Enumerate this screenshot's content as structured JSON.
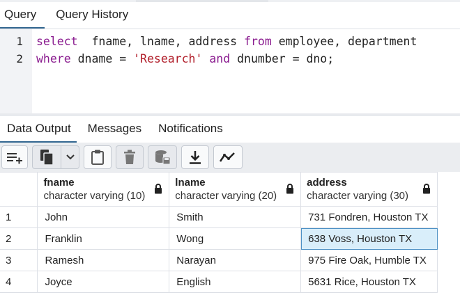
{
  "top_tabs": [
    {
      "label": "Query",
      "active": true
    },
    {
      "label": "Query History",
      "active": false
    }
  ],
  "editor": {
    "line_numbers": [
      "1",
      "2"
    ],
    "lines": [
      [
        {
          "text": "select",
          "kind": "kw"
        },
        {
          "text": "  fname, lname, address ",
          "kind": "plain"
        },
        {
          "text": "from",
          "kind": "kw"
        },
        {
          "text": " employee, department",
          "kind": "plain"
        }
      ],
      [
        {
          "text": "where",
          "kind": "kw"
        },
        {
          "text": " dname = ",
          "kind": "plain"
        },
        {
          "text": "'Research'",
          "kind": "str"
        },
        {
          "text": " ",
          "kind": "plain"
        },
        {
          "text": "and",
          "kind": "kw"
        },
        {
          "text": " dnumber = dno;",
          "kind": "plain"
        }
      ]
    ]
  },
  "bottom_tabs": [
    {
      "label": "Data Output",
      "active": true
    },
    {
      "label": "Messages",
      "active": false
    },
    {
      "label": "Notifications",
      "active": false
    }
  ],
  "toolbar": {
    "icons": [
      "add-row-icon",
      "copy-icon",
      "chevron-down-icon",
      "paste-icon",
      "delete-icon",
      "save-data-icon",
      "download-icon",
      "graph-icon"
    ]
  },
  "grid": {
    "columns": [
      {
        "name": "fname",
        "type": "character varying (10)"
      },
      {
        "name": "lname",
        "type": "character varying (20)"
      },
      {
        "name": "address",
        "type": "character varying (30)"
      }
    ],
    "rows": [
      {
        "num": "1",
        "cells": [
          "John",
          "Smith",
          "731 Fondren, Houston TX"
        ]
      },
      {
        "num": "2",
        "cells": [
          "Franklin",
          "Wong",
          "638 Voss, Houston TX"
        ]
      },
      {
        "num": "3",
        "cells": [
          "Ramesh",
          "Narayan",
          "975 Fire Oak, Humble TX"
        ]
      },
      {
        "num": "4",
        "cells": [
          "Joyce",
          "English",
          "5631 Rice, Houston TX"
        ]
      }
    ],
    "selected_cell": {
      "row": 1,
      "col": 2
    }
  },
  "colors": {
    "active_tab_underline": "#326690",
    "keyword": "#8a1b8f",
    "string": "#b11e2a",
    "selected_cell_bg": "#d9eefa",
    "selected_cell_border": "#4d90c4"
  }
}
